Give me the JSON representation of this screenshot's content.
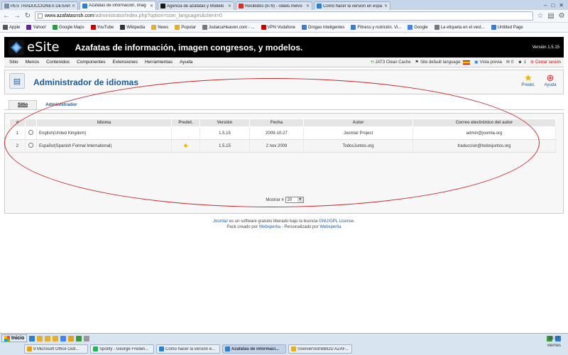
{
  "browser": {
    "tabs": [
      {
        "title": "PES TRADUCCIONES DESAPA",
        "color": "#7a8ca8"
      },
      {
        "title": "Azafatas de información, imag",
        "color": "#2f7fd0"
      },
      {
        "title": "Agencia de azafatas y Modelo",
        "color": "#1a1a1a"
      },
      {
        "title": "Recibidos (879) - odalis.melvo",
        "color": "#d93025"
      },
      {
        "title": "Cómo hacer la versión en espa",
        "color": "#2f7fd0"
      }
    ],
    "url_host": "www.azafatasnsh.com",
    "url_path": "/administrator/index.php?option=com_languages&client=0",
    "bookmarks": [
      {
        "label": "Apple",
        "color": "#555555"
      },
      {
        "label": "Yahoo!",
        "color": "#6b1fa3"
      },
      {
        "label": "Google Maps",
        "color": "#2a9d3f"
      },
      {
        "label": "YouTube",
        "color": "#d00000"
      },
      {
        "label": "Wikipedia",
        "color": "#333333"
      },
      {
        "label": "News",
        "color": "#e3b02e"
      },
      {
        "label": "Popular",
        "color": "#e3b02e"
      },
      {
        "label": "JudaicaHeaven.com - ...",
        "color": "#777777"
      },
      {
        "label": "VPN Vodafone",
        "color": "#d00000"
      },
      {
        "label": "Drogas inteligentes",
        "color": "#3a7bd5"
      },
      {
        "label": "Fitness y nutrición. Vi...",
        "color": "#3a7bd5"
      },
      {
        "label": "Google",
        "color": "#4285f4"
      },
      {
        "label": "La etiqueta en el vest...",
        "color": "#777777"
      },
      {
        "label": "Untitled Page",
        "color": "#3a7bd5"
      }
    ]
  },
  "site": {
    "logo": "eSite",
    "title": "Azafatas de información, imagen congresos, y modelos.",
    "version": "Versión 1.5.15"
  },
  "menu": [
    "Sitio",
    "Menús",
    "Contenidos",
    "Componentes",
    "Extensiones",
    "Herramientas",
    "Ayuda"
  ],
  "status": {
    "cache": "JAT3 Clean Cache",
    "lang": "Site default language:",
    "preview": "Vista previa",
    "messages": "0",
    "users": "1",
    "logout": "Cerrar sesión"
  },
  "toolbar": {
    "title": "Administrador de idiomas",
    "default_label": "Predet.",
    "help_label": "Ayuda"
  },
  "subtabs": [
    "Sitio",
    "Administrador"
  ],
  "table": {
    "headers": [
      "#",
      "",
      "Idioma",
      "Predet.",
      "Versión",
      "Fecha",
      "Autor",
      "Correo electrónico del autor"
    ],
    "rows": [
      {
        "num": "1",
        "language": "English(United Kingdom)",
        "default": false,
        "version": "1.5.15",
        "date": "2009-10-27",
        "author": "Joomla! Project",
        "email": "admin@joomla.org"
      },
      {
        "num": "2",
        "language": "Español(Spanish Formal International)",
        "default": true,
        "version": "1.5.15",
        "date": "2 nov 2009",
        "author": "TodosJuntos.org",
        "email": "traduccion@todosjuntos.org"
      }
    ],
    "pager_label": "Mostrar #",
    "pager_value": "20"
  },
  "footer": {
    "joomla": "Joomla!",
    "text1": " es un software gratuito liberado bajo la licencia ",
    "license": "GNU/GPL License.",
    "text2": "Pack creado por ",
    "webxpertia1": "Webxpertia",
    "text3": " - Personalizado por ",
    "webxpertia2": "Webxpertia"
  },
  "taskbar": {
    "start": "Inicio",
    "tasks": [
      {
        "label": "9 Microsoft Office Outl...",
        "color": "#e3a21a"
      },
      {
        "label": "Spotify - George Frederi...",
        "color": "#1db954"
      },
      {
        "label": "Cómo hacer la versión e...",
        "color": "#2f7fd0"
      },
      {
        "label": "Azafatas de informaci...",
        "color": "#2f7fd0"
      },
      {
        "label": "\\\\Server\\nsh\\BBDD AZAF...",
        "color": "#e3b02e"
      }
    ],
    "time": "16:17",
    "day": "viernes"
  }
}
